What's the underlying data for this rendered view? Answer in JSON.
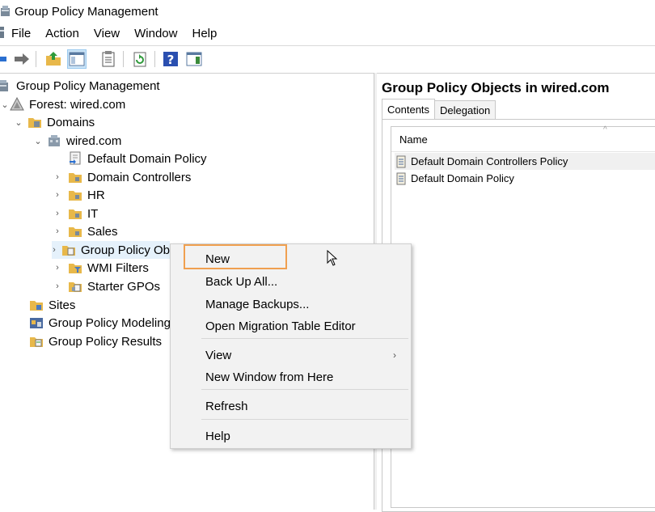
{
  "window": {
    "title": "Group Policy Management"
  },
  "menu": {
    "items": [
      "File",
      "Action",
      "View",
      "Window",
      "Help"
    ]
  },
  "toolbar": {
    "icons": [
      "back-icon",
      "forward-icon",
      "up-folder-icon",
      "show-hide-tree-icon",
      "properties-icon",
      "refresh-icon",
      "help-icon",
      "action-pane-icon"
    ]
  },
  "tree": {
    "root": "Group Policy Management",
    "forest": "Forest: wired.com",
    "domains": "Domains",
    "domain": "wired.com",
    "default_domain_policy": "Default Domain Policy",
    "domain_controllers": "Domain Controllers",
    "hr": "HR",
    "it": "IT",
    "sales": "Sales",
    "gpo": "Group Policy Ob",
    "wmi_filters": "WMI Filters",
    "starter_gpos": "Starter GPOs",
    "sites": "Sites",
    "modeling": "Group Policy Modeling",
    "results": "Group Policy Results"
  },
  "right_pane": {
    "title": "Group Policy Objects in wired.com",
    "tabs": [
      "Contents",
      "Delegation"
    ],
    "column_name": "Name",
    "rows": [
      "Default Domain Controllers Policy",
      "Default Domain Policy"
    ]
  },
  "context_menu": {
    "new": "New",
    "back_up_all": "Back Up All...",
    "manage_backups": "Manage Backups...",
    "open_migration": "Open Migration Table Editor",
    "view": "View",
    "new_window": "New Window from Here",
    "refresh": "Refresh",
    "help": "Help"
  },
  "colors": {
    "highlight": "#f0a050",
    "selection": "#e5f1fb"
  }
}
